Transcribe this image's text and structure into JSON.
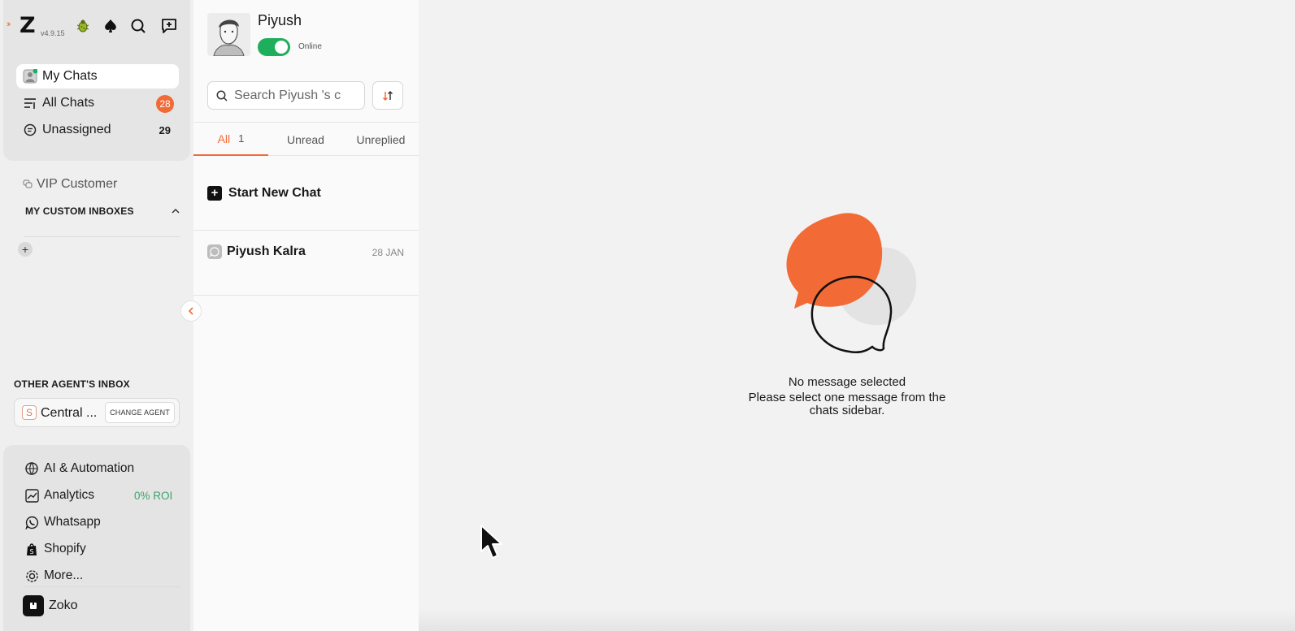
{
  "nav": {
    "version": "v4.9.15",
    "expand": "››",
    "logo": "Z",
    "items": [
      {
        "label": "My Chats",
        "active": true
      },
      {
        "label": "All Chats",
        "count": "28"
      },
      {
        "label": "Unassigned",
        "count": "29"
      }
    ],
    "vip_label": "VIP Customer",
    "custom_inboxes_title": "MY CUSTOM INBOXES",
    "add_symbol": "+",
    "other_agents_title": "OTHER AGENT'S INBOX",
    "agent": {
      "initial": "S",
      "name": "Central ...",
      "change_label": "CHANGE AGENT"
    },
    "bottom_items": [
      {
        "label": "AI & Automation"
      },
      {
        "label": "Analytics",
        "extra": "0% ROI"
      },
      {
        "label": "Whatsapp"
      },
      {
        "label": "Shopify"
      },
      {
        "label": "More..."
      }
    ],
    "brand": "Zoko"
  },
  "list": {
    "user_name": "Piyush",
    "status": "Online",
    "status_on": true,
    "search": {
      "placeholder": "Search Piyush 's c"
    },
    "tabs": [
      {
        "label": "All",
        "count": "1",
        "active": true
      },
      {
        "label": "Unread"
      },
      {
        "label": "Unreplied"
      }
    ],
    "new_chat_label": "Start New Chat",
    "chats": [
      {
        "name": "Piyush Kalra",
        "date": "28 JAN",
        "channel": "whatsapp-icon"
      }
    ]
  },
  "main": {
    "empty_title": "No message selected",
    "empty_line1": "Please select one message from the",
    "empty_line2": "chats sidebar."
  },
  "colors": {
    "accent": "#f26a35",
    "online": "#1fae5b",
    "roi": "#3aa56a"
  }
}
